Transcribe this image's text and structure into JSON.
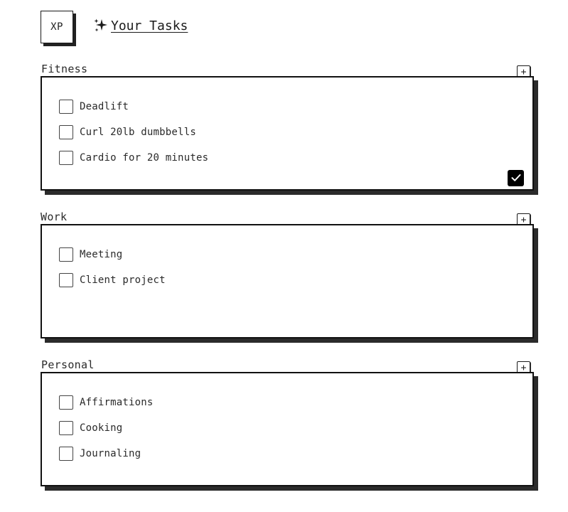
{
  "header": {
    "badge": "XP",
    "title": "Your Tasks",
    "title_icon": "sparkles-icon"
  },
  "sections": [
    {
      "label": "Fitness",
      "add_icon": "plus",
      "add_label": "+",
      "tasks": [
        {
          "label": "Deadlift",
          "checked": false
        },
        {
          "label": "Curl 20lb dumbbells",
          "checked": false
        },
        {
          "label": "Cardio for 20 minutes",
          "checked": false
        }
      ],
      "complete_button": {
        "icon": "checkmark-icon",
        "visible": true
      }
    },
    {
      "label": "Work",
      "add_icon": "plus",
      "add_label": "+",
      "tasks": [
        {
          "label": "Meeting",
          "checked": false
        },
        {
          "label": "Client project",
          "checked": false
        }
      ]
    },
    {
      "label": "Personal",
      "add_icon": "plus",
      "add_label": "+",
      "tasks": [
        {
          "label": "Affirmations",
          "checked": false
        },
        {
          "label": "Cooking",
          "checked": false
        },
        {
          "label": "Journaling",
          "checked": false
        }
      ]
    }
  ],
  "colors": {
    "border": "#111111",
    "shadow": "#2b2b2b",
    "text": "#2a2a2a",
    "background": "#ffffff"
  }
}
